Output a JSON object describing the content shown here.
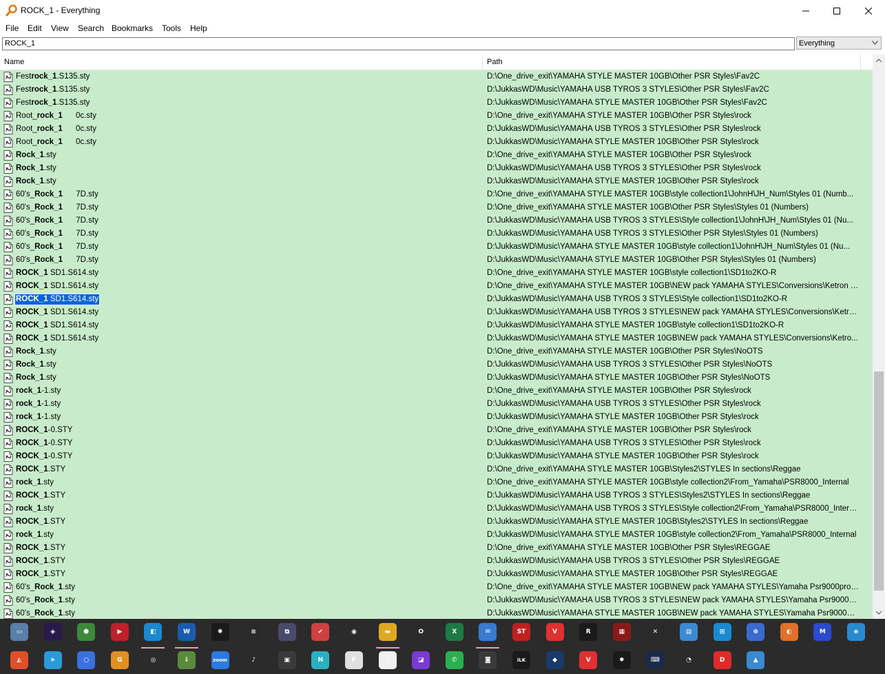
{
  "window": {
    "title": "ROCK_1 - Everything"
  },
  "menu": {
    "items": [
      "File",
      "Edit",
      "View",
      "Search",
      "Bookmarks",
      "Tools",
      "Help"
    ]
  },
  "search": {
    "value": "ROCK_1",
    "filter": "Everything"
  },
  "columns": {
    "name": "Name",
    "path": "Path"
  },
  "colors": {
    "row_bg": "#c8eccb",
    "selection": "#0a64d8",
    "taskbar": "#2b2b2b"
  },
  "rows": [
    {
      "pre": "Fest",
      "bold": "rock_1",
      "post": ".S135.sty",
      "path": "D:\\One_drive_exit\\YAMAHA STYLE MASTER 10GB\\Other PSR Styles\\Fav2C"
    },
    {
      "pre": "Fest",
      "bold": "rock_1",
      "post": ".S135.sty",
      "path": "D:\\JukkasWD\\Music\\YAMAHA USB TYROS 3 STYLES\\Other PSR Styles\\Fav2C"
    },
    {
      "pre": "Fest",
      "bold": "rock_1",
      "post": ".S135.sty",
      "path": "D:\\JukkasWD\\Music\\YAMAHA STYLE MASTER 10GB\\Other PSR Styles\\Fav2C"
    },
    {
      "pre": "Root_",
      "bold": "rock_1",
      "post": "      0c.sty",
      "path": "D:\\One_drive_exit\\YAMAHA STYLE MASTER 10GB\\Other PSR Styles\\rock"
    },
    {
      "pre": "Root_",
      "bold": "rock_1",
      "post": "      0c.sty",
      "path": "D:\\JukkasWD\\Music\\YAMAHA USB TYROS 3 STYLES\\Other PSR Styles\\rock"
    },
    {
      "pre": "Root_",
      "bold": "rock_1",
      "post": "      0c.sty",
      "path": "D:\\JukkasWD\\Music\\YAMAHA STYLE MASTER 10GB\\Other PSR Styles\\rock"
    },
    {
      "pre": "",
      "bold": "Rock_1",
      "post": ".sty",
      "path": "D:\\One_drive_exit\\YAMAHA STYLE MASTER 10GB\\Other PSR Styles\\rock"
    },
    {
      "pre": "",
      "bold": "Rock_1",
      "post": ".sty",
      "path": "D:\\JukkasWD\\Music\\YAMAHA USB TYROS 3 STYLES\\Other PSR Styles\\rock"
    },
    {
      "pre": "",
      "bold": "Rock_1",
      "post": ".sty",
      "path": "D:\\JukkasWD\\Music\\YAMAHA STYLE MASTER 10GB\\Other PSR Styles\\rock"
    },
    {
      "pre": "60's_",
      "bold": "Rock_1",
      "post": "      7D.sty",
      "path": "D:\\One_drive_exit\\YAMAHA STYLE MASTER 10GB\\style collection1\\JohnH\\JH_Num\\Styles 01 (Numb..."
    },
    {
      "pre": "60's_",
      "bold": "Rock_1",
      "post": "      7D.sty",
      "path": "D:\\One_drive_exit\\YAMAHA STYLE MASTER 10GB\\Other PSR Styles\\Styles 01 (Numbers)"
    },
    {
      "pre": "60's_",
      "bold": "Rock_1",
      "post": "      7D.sty",
      "path": "D:\\JukkasWD\\Music\\YAMAHA USB TYROS 3 STYLES\\Style collection1\\JohnH\\JH_Num\\Styles 01 (Nu..."
    },
    {
      "pre": "60's_",
      "bold": "Rock_1",
      "post": "      7D.sty",
      "path": "D:\\JukkasWD\\Music\\YAMAHA USB TYROS 3 STYLES\\Other PSR Styles\\Styles 01 (Numbers)"
    },
    {
      "pre": "60's_",
      "bold": "Rock_1",
      "post": "      7D.sty",
      "path": "D:\\JukkasWD\\Music\\YAMAHA STYLE MASTER 10GB\\style collection1\\JohnH\\JH_Num\\Styles 01 (Nu..."
    },
    {
      "pre": "60's_",
      "bold": "Rock_1",
      "post": "      7D.sty",
      "path": "D:\\JukkasWD\\Music\\YAMAHA STYLE MASTER 10GB\\Other PSR Styles\\Styles 01 (Numbers)"
    },
    {
      "pre": "",
      "bold": "ROCK_1",
      "post": " SD1.S614.sty",
      "path": "D:\\One_drive_exit\\YAMAHA STYLE MASTER 10GB\\style collection1\\SD1to2KO-R"
    },
    {
      "pre": "",
      "bold": "ROCK_1",
      "post": " SD1.S614.sty",
      "path": "D:\\One_drive_exit\\YAMAHA STYLE MASTER 10GB\\NEW pack YAMAHA STYLES\\Conversions\\Ketron S..."
    },
    {
      "pre": "",
      "bold": "ROCK_1",
      "post": " SD1.S614.sty",
      "path": "D:\\JukkasWD\\Music\\YAMAHA USB TYROS 3 STYLES\\Style collection1\\SD1to2KO-R",
      "selected": true
    },
    {
      "pre": "",
      "bold": "ROCK_1",
      "post": " SD1.S614.sty",
      "path": "D:\\JukkasWD\\Music\\YAMAHA USB TYROS 3 STYLES\\NEW pack YAMAHA STYLES\\Conversions\\Ketro..."
    },
    {
      "pre": "",
      "bold": "ROCK_1",
      "post": " SD1.S614.sty",
      "path": "D:\\JukkasWD\\Music\\YAMAHA STYLE MASTER 10GB\\style collection1\\SD1to2KO-R"
    },
    {
      "pre": "",
      "bold": "ROCK_1",
      "post": " SD1.S614.sty",
      "path": "D:\\JukkasWD\\Music\\YAMAHA STYLE MASTER 10GB\\NEW pack YAMAHA STYLES\\Conversions\\Ketro..."
    },
    {
      "pre": "",
      "bold": "Rock_1",
      "post": ".sty",
      "path": "D:\\One_drive_exit\\YAMAHA STYLE MASTER 10GB\\Other PSR Styles\\NoOTS"
    },
    {
      "pre": "",
      "bold": "Rock_1",
      "post": ".sty",
      "path": "D:\\JukkasWD\\Music\\YAMAHA USB TYROS 3 STYLES\\Other PSR Styles\\NoOTS"
    },
    {
      "pre": "",
      "bold": "Rock_1",
      "post": ".sty",
      "path": "D:\\JukkasWD\\Music\\YAMAHA STYLE MASTER 10GB\\Other PSR Styles\\NoOTS"
    },
    {
      "pre": "",
      "bold": "rock_1",
      "post": "-1.sty",
      "path": "D:\\One_drive_exit\\YAMAHA STYLE MASTER 10GB\\Other PSR Styles\\rock"
    },
    {
      "pre": "",
      "bold": "rock_1",
      "post": "-1.sty",
      "path": "D:\\JukkasWD\\Music\\YAMAHA USB TYROS 3 STYLES\\Other PSR Styles\\rock"
    },
    {
      "pre": "",
      "bold": "rock_1",
      "post": "-1.sty",
      "path": "D:\\JukkasWD\\Music\\YAMAHA STYLE MASTER 10GB\\Other PSR Styles\\rock"
    },
    {
      "pre": "",
      "bold": "ROCK_1",
      "post": "-0.STY",
      "path": "D:\\One_drive_exit\\YAMAHA STYLE MASTER 10GB\\Other PSR Styles\\rock"
    },
    {
      "pre": "",
      "bold": "ROCK_1",
      "post": "-0.STY",
      "path": "D:\\JukkasWD\\Music\\YAMAHA USB TYROS 3 STYLES\\Other PSR Styles\\rock"
    },
    {
      "pre": "",
      "bold": "ROCK_1",
      "post": "-0.STY",
      "path": "D:\\JukkasWD\\Music\\YAMAHA STYLE MASTER 10GB\\Other PSR Styles\\rock"
    },
    {
      "pre": "",
      "bold": "ROCK_1",
      "post": ".STY",
      "path": "D:\\One_drive_exit\\YAMAHA STYLE MASTER 10GB\\Styles2\\STYLES In sections\\Reggae"
    },
    {
      "pre": "",
      "bold": "rock_1",
      "post": ".sty",
      "path": "D:\\One_drive_exit\\YAMAHA STYLE MASTER 10GB\\style collection2\\From_Yamaha\\PSR8000_Internal"
    },
    {
      "pre": "",
      "bold": "ROCK_1",
      "post": ".STY",
      "path": "D:\\JukkasWD\\Music\\YAMAHA USB TYROS 3 STYLES\\Styles2\\STYLES In sections\\Reggae"
    },
    {
      "pre": "",
      "bold": "rock_1",
      "post": ".sty",
      "path": "D:\\JukkasWD\\Music\\YAMAHA USB TYROS 3 STYLES\\Style collection2\\From_Yamaha\\PSR8000_Internal"
    },
    {
      "pre": "",
      "bold": "ROCK_1",
      "post": ".STY",
      "path": "D:\\JukkasWD\\Music\\YAMAHA STYLE MASTER 10GB\\Styles2\\STYLES In sections\\Reggae"
    },
    {
      "pre": "",
      "bold": "rock_1",
      "post": ".sty",
      "path": "D:\\JukkasWD\\Music\\YAMAHA STYLE MASTER 10GB\\style collection2\\From_Yamaha\\PSR8000_Internal"
    },
    {
      "pre": "",
      "bold": "ROCK_1",
      "post": ".STY",
      "path": "D:\\One_drive_exit\\YAMAHA STYLE MASTER 10GB\\Other PSR Styles\\REGGAE"
    },
    {
      "pre": "",
      "bold": "ROCK_1",
      "post": ".STY",
      "path": "D:\\JukkasWD\\Music\\YAMAHA USB TYROS 3 STYLES\\Other PSR Styles\\REGGAE"
    },
    {
      "pre": "",
      "bold": "ROCK_1",
      "post": ".STY",
      "path": "D:\\JukkasWD\\Music\\YAMAHA STYLE MASTER 10GB\\Other PSR Styles\\REGGAE"
    },
    {
      "pre": "60's_",
      "bold": "Rock_1",
      "post": ".sty",
      "path": "D:\\One_drive_exit\\YAMAHA STYLE MASTER 10GB\\NEW pack YAMAHA STYLES\\Yamaha Psr9000pro\\P..."
    },
    {
      "pre": "60's_",
      "bold": "Rock_1",
      "post": ".sty",
      "path": "D:\\JukkasWD\\Music\\YAMAHA USB TYROS 3 STYLES\\NEW pack YAMAHA STYLES\\Yamaha Psr9000pro..."
    },
    {
      "pre": "60's_",
      "bold": "Rock_1",
      "post": ".sty",
      "path": "D:\\JukkasWD\\Music\\YAMAHA STYLE MASTER 10GB\\NEW pack YAMAHA STYLES\\Yamaha Psr9000pro..."
    }
  ],
  "taskbar": {
    "row1": [
      {
        "icon": "display-settings-icon",
        "color": "#5a7fa8",
        "glyph": "▭"
      },
      {
        "icon": "premiere-icon",
        "color": "#2a1a4a",
        "glyph": "◈"
      },
      {
        "icon": "shield-app-icon",
        "color": "#3a8a3a",
        "glyph": "⬢"
      },
      {
        "icon": "media-player-icon",
        "color": "#c0202a",
        "glyph": "▶"
      },
      {
        "icon": "window-app-icon",
        "color": "#1a8ad0",
        "glyph": "◧"
      },
      {
        "icon": "word-icon",
        "color": "#1a5bb0",
        "glyph": "W"
      },
      {
        "icon": "davinci-icon",
        "color": "#1a1a1a",
        "glyph": "✺"
      },
      {
        "icon": "waveform-icon",
        "color": "#2a2a2a",
        "glyph": "≋"
      },
      {
        "icon": "network-icon",
        "color": "#4a4a6a",
        "glyph": "⧉"
      },
      {
        "icon": "checklist-icon",
        "color": "#d04040",
        "glyph": "✔"
      },
      {
        "icon": "chrome-icon",
        "color": "#2b2b2b",
        "glyph": "◉"
      },
      {
        "icon": "file-explorer-icon",
        "color": "#e0a820",
        "glyph": "▬"
      },
      {
        "icon": "opera-icon",
        "color": "#2b2b2b",
        "glyph": "O"
      },
      {
        "icon": "excel-icon",
        "color": "#1e7a45",
        "glyph": "X"
      },
      {
        "icon": "mail-icon",
        "color": "#3a7ad0",
        "glyph": "✉"
      },
      {
        "icon": "st-app-icon",
        "color": "#c02020",
        "glyph": "ST"
      },
      {
        "icon": "vivaldi-icon",
        "color": "#e03030",
        "glyph": "V"
      },
      {
        "icon": "ryzen-icon",
        "color": "#1a1a1a",
        "glyph": "R"
      },
      {
        "icon": "rog-cpu-icon",
        "color": "#8a1a1a",
        "glyph": "▦"
      },
      {
        "icon": "xbox-icon",
        "color": "#2a2a2a",
        "glyph": "✕"
      },
      {
        "icon": "id-card-icon",
        "color": "#3a8ad0",
        "glyph": "▤"
      },
      {
        "icon": "translate-icon",
        "color": "#1a8ad0",
        "glyph": "⊞"
      },
      {
        "icon": "globe-settings-icon",
        "color": "#3a6ad0",
        "glyph": "⊕"
      },
      {
        "icon": "firefox-icon",
        "color": "#e0702a",
        "glyph": "◐"
      },
      {
        "icon": "malwarebytes-icon",
        "color": "#2a4ad0",
        "glyph": "M"
      },
      {
        "icon": "ie-globe-icon",
        "color": "#2a8ad0",
        "glyph": "e"
      }
    ],
    "row2": [
      {
        "icon": "brave-icon",
        "color": "#e0502a",
        "glyph": "◭"
      },
      {
        "icon": "telegram-icon",
        "color": "#2a9ad8",
        "glyph": "➤"
      },
      {
        "icon": "signal-icon",
        "color": "#3a70e0",
        "glyph": "○"
      },
      {
        "icon": "g-app-icon",
        "color": "#e09020",
        "glyph": "G"
      },
      {
        "icon": "obs-icon",
        "color": "#2b2b2b",
        "glyph": "◎"
      },
      {
        "icon": "download-icon",
        "color": "#5a8a3a",
        "glyph": "⇩"
      },
      {
        "icon": "zoom-icon",
        "color": "#2a7ae0",
        "glyph": "zoom"
      },
      {
        "icon": "music-player-icon",
        "color": "#2b2b2b",
        "glyph": "♪"
      },
      {
        "icon": "video-editor-icon",
        "color": "#3a3a3a",
        "glyph": "▣"
      },
      {
        "icon": "n-app-icon",
        "color": "#2ab0c0",
        "glyph": "N"
      },
      {
        "icon": "flipboard-icon",
        "color": "#e0e0e0",
        "glyph": "F"
      },
      {
        "icon": "document-icon",
        "color": "#f0f0f0",
        "glyph": "▯"
      },
      {
        "icon": "clapper-icon",
        "color": "#7a3ad0",
        "glyph": "◪"
      },
      {
        "icon": "whatsapp-icon",
        "color": "#2ab050",
        "glyph": "✆"
      },
      {
        "icon": "gamepad-icon",
        "color": "#3a3a3a",
        "glyph": "◙"
      },
      {
        "icon": "ilok-icon",
        "color": "#1a1a1a",
        "glyph": "iLK"
      },
      {
        "icon": "bitwarden-icon",
        "color": "#1a3a6a",
        "glyph": "◆"
      },
      {
        "icon": "vivaldi-alt-icon",
        "color": "#e03030",
        "glyph": "V"
      },
      {
        "icon": "gear-red-icon",
        "color": "#1a1a1a",
        "glyph": "✹"
      },
      {
        "icon": "keyboard-icon",
        "color": "#1a2a4a",
        "glyph": "⌨"
      },
      {
        "icon": "speedometer-icon",
        "color": "#2b2b2b",
        "glyph": "◔"
      },
      {
        "icon": "d-app-icon",
        "color": "#e02a2a",
        "glyph": "D"
      },
      {
        "icon": "photos-icon",
        "color": "#3a8ad0",
        "glyph": "▲"
      }
    ]
  }
}
